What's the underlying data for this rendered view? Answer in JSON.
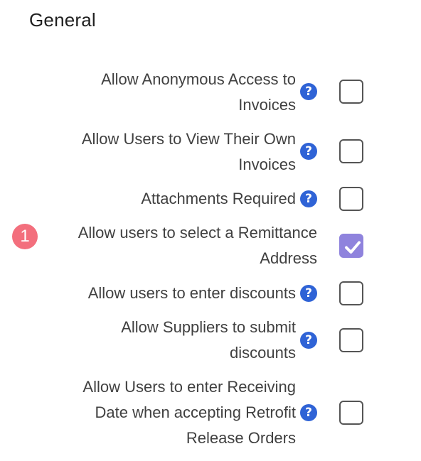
{
  "section_title": "General",
  "settings": [
    {
      "line1": "Allow Anonymous Access to",
      "line2": "Invoices",
      "checked": false
    },
    {
      "line1": "Allow Users to View Their Own",
      "line2": "Invoices",
      "checked": false
    },
    {
      "line1": "Attachments Required",
      "checked": false
    },
    {
      "line1": "Allow users to select a Remittance",
      "line2": "Address",
      "checked": true
    },
    {
      "line1": "Allow users to enter discounts",
      "checked": false
    },
    {
      "line1": "Allow Suppliers to submit",
      "line2": "discounts",
      "checked": false
    },
    {
      "line1": "Allow Users to enter Receiving",
      "line2": "Date when accepting Retrofit",
      "line3": "Release Orders",
      "checked": false
    }
  ],
  "help_icon_glyph": "?",
  "step_badge": "1",
  "colors": {
    "help_icon": "#2f63d6",
    "checked_box": "#8f83dd",
    "step_badge": "#f36f7d"
  }
}
